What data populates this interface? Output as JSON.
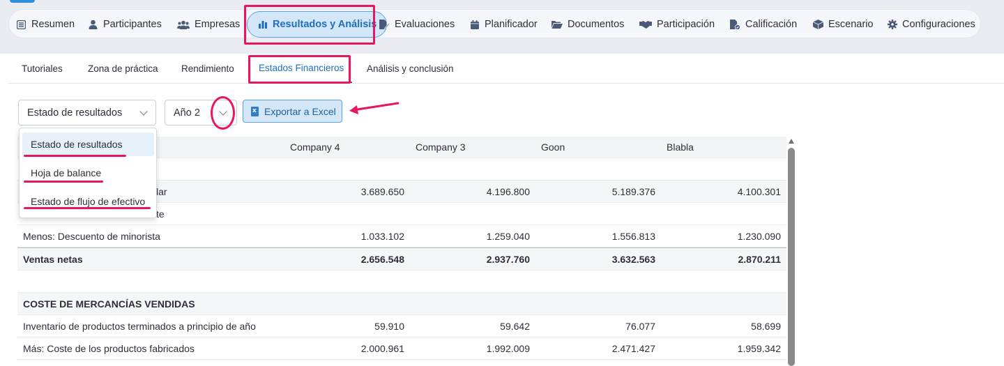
{
  "nav": {
    "items": [
      {
        "label": "Resumen",
        "icon": "list-icon"
      },
      {
        "label": "Participantes",
        "icon": "user-icon"
      },
      {
        "label": "Empresas",
        "icon": "users-icon"
      },
      {
        "label": "Resultados y Análisis",
        "icon": "bar-chart-icon",
        "active": true
      },
      {
        "label": "Evaluaciones",
        "icon": "edit-document-icon"
      },
      {
        "label": "Planificador",
        "icon": "calendar-icon"
      },
      {
        "label": "Documentos",
        "icon": "folder-open-icon"
      },
      {
        "label": "Participación",
        "icon": "handshake-icon"
      },
      {
        "label": "Calificación",
        "icon": "grade-document-icon"
      },
      {
        "label": "Escenario",
        "icon": "box-icon"
      },
      {
        "label": "Configuraciones",
        "icon": "gear-icon"
      }
    ]
  },
  "subtabs": [
    {
      "label": "Tutoriales"
    },
    {
      "label": "Zona de práctica"
    },
    {
      "label": "Rendimiento"
    },
    {
      "label": "Estados Financieros",
      "active": true
    },
    {
      "label": "Análisis y conclusión"
    }
  ],
  "controls": {
    "statement_select": "Estado de resultados",
    "year_select": "Año 2",
    "export_label": "Exportar a Excel"
  },
  "dropdown": {
    "options": [
      "Estado de resultados",
      "Hoja de balance",
      "Estado de flujo de efectivo"
    ],
    "selected": "Estado de resultados"
  },
  "table": {
    "columns": [
      "Company 4",
      "Company 3",
      "Goon",
      "Blabla"
    ],
    "rows": [
      {
        "label": "",
        "values": [
          "",
          "",
          "",
          ""
        ]
      },
      {
        "label": "lar",
        "values": [
          "3.689.650",
          "4.196.800",
          "5.189.376",
          "4.100.301"
        ]
      },
      {
        "label": "te",
        "values": [
          "",
          "",
          "",
          ""
        ]
      },
      {
        "label": "Menos: Descuento de minorista",
        "values": [
          "1.033.102",
          "1.259.040",
          "1.556.813",
          "1.230.090"
        ]
      },
      {
        "label": "Ventas netas",
        "values": [
          "2.656.548",
          "2.937.760",
          "3.632.563",
          "2.870.211"
        ]
      },
      {
        "label": "",
        "values": [
          "",
          "",
          "",
          ""
        ]
      },
      {
        "label": "COSTE DE MERCANCÍAS VENDIDAS",
        "values": [
          "",
          "",
          "",
          ""
        ]
      },
      {
        "label": "Inventario de productos terminados a principio de año",
        "values": [
          "59.910",
          "59.642",
          "76.077",
          "58.699"
        ]
      },
      {
        "label": "Más: Coste de los productos fabricados",
        "values": [
          "2.000.961",
          "1.992.009",
          "2.471.427",
          "1.959.342"
        ]
      }
    ]
  },
  "colors": {
    "accent": "#1e6fbf",
    "annotation": "#e8175d",
    "active_bg": "#d3e7f8"
  }
}
